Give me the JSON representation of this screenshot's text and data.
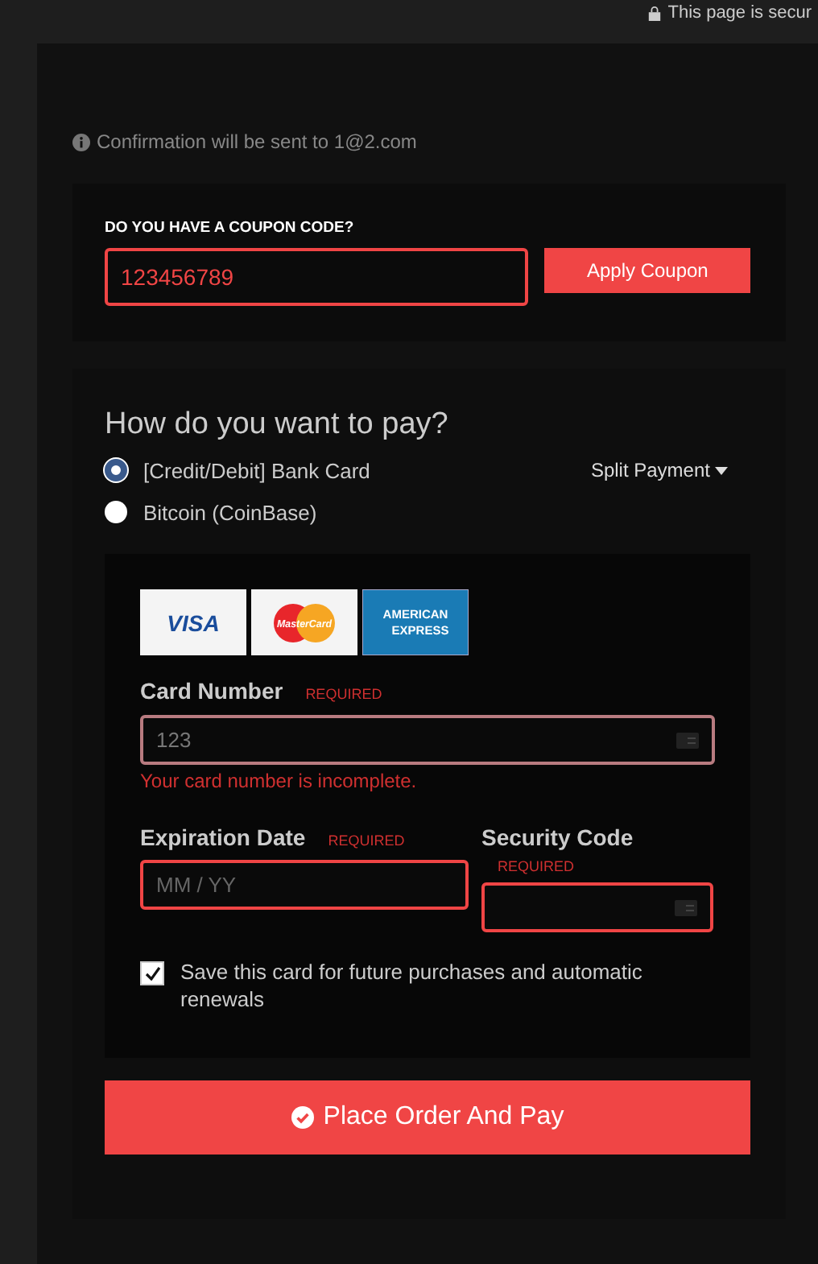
{
  "security_note": "This page is secur",
  "confirmation": "Confirmation will be sent to 1@2.com",
  "coupon": {
    "heading": "DO YOU HAVE A COUPON CODE?",
    "value": "123456789",
    "button": "Apply Coupon"
  },
  "payment": {
    "heading": "How do you want to pay?",
    "split_payment": "Split Payment",
    "methods": [
      {
        "label": "[Credit/Debit] Bank Card",
        "selected": true
      },
      {
        "label": "Bitcoin (CoinBase)",
        "selected": false
      }
    ],
    "cards": [
      {
        "kind": "visa",
        "label": "VISA"
      },
      {
        "kind": "mastercard",
        "label": "MasterCard"
      },
      {
        "kind": "amex",
        "label": "AMERICAN",
        "label_2": "EXPRESS"
      }
    ],
    "card_number": {
      "label": "Card Number",
      "required": "REQUIRED",
      "value": "123",
      "error": "Your card number is incomplete."
    },
    "expiration": {
      "label": "Expiration Date",
      "required": "REQUIRED",
      "placeholder": "MM / YY"
    },
    "security_code": {
      "label": "Security Code",
      "required": "REQUIRED"
    },
    "save_card": {
      "label": "Save this card for future purchases and automatic renewals",
      "checked": true
    },
    "submit": "Place Order And Pay"
  }
}
